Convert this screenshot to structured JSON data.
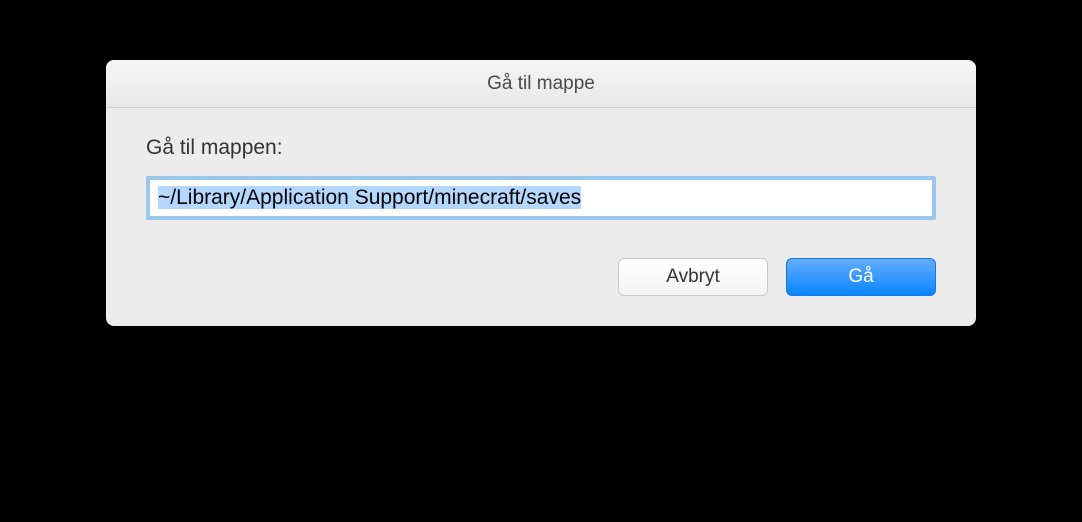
{
  "dialog": {
    "title": "Gå til mappe",
    "label": "Gå til mappen:",
    "path_value": "~/Library/Application Support/minecraft/saves",
    "cancel_label": "Avbryt",
    "go_label": "Gå"
  }
}
